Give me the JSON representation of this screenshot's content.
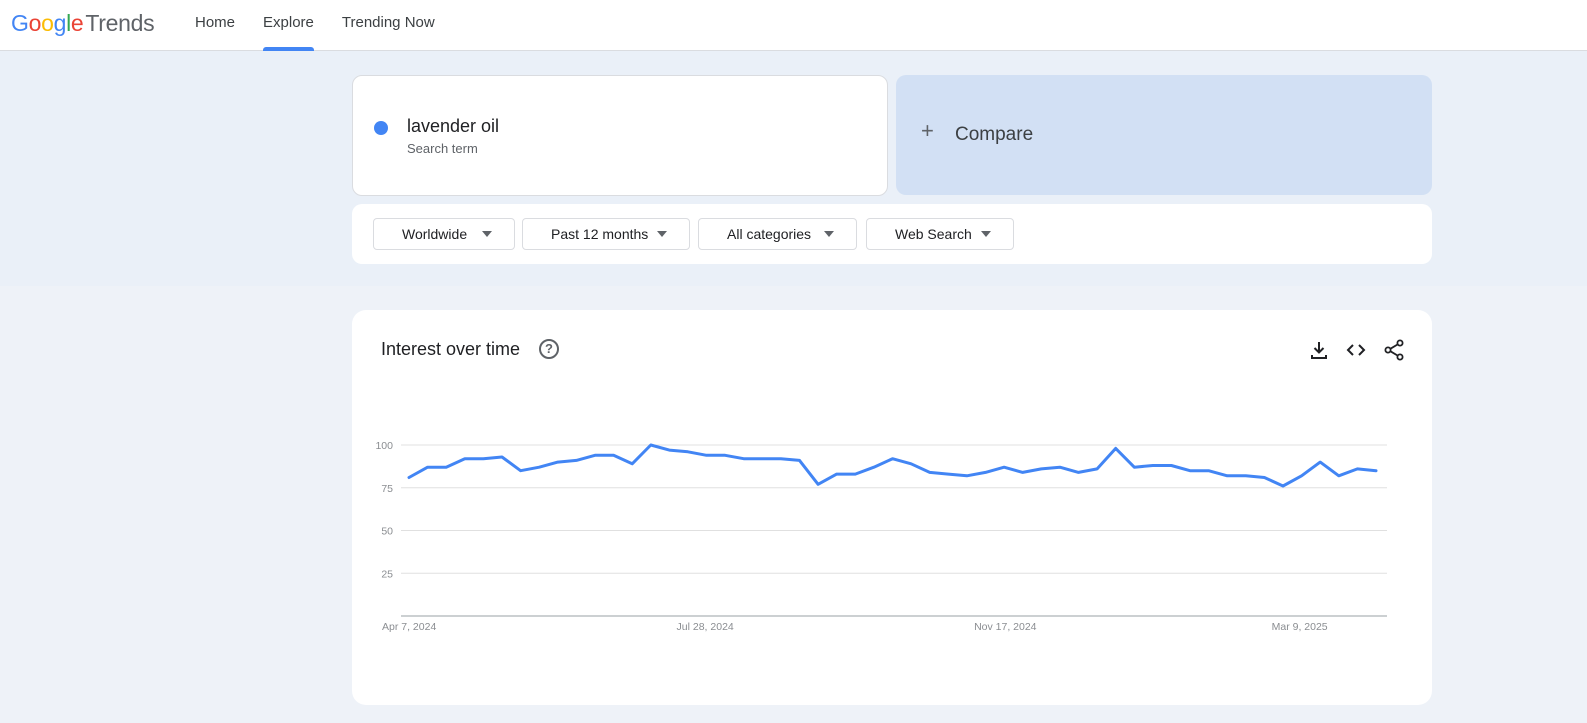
{
  "header": {
    "logo_google": "Google",
    "logo_trends": "Trends",
    "nav": [
      {
        "label": "Home",
        "active": false
      },
      {
        "label": "Explore",
        "active": true
      },
      {
        "label": "Trending Now",
        "active": false
      }
    ]
  },
  "search": {
    "term": "lavender oil",
    "term_type": "Search term",
    "term_color": "#4285f4",
    "compare_label": "Compare"
  },
  "filters": {
    "region": "Worldwide",
    "time_range": "Past 12 months",
    "category": "All categories",
    "search_type": "Web Search"
  },
  "interest_over_time": {
    "title": "Interest over time",
    "tools": [
      "download-icon",
      "embed-code-icon",
      "share-icon"
    ]
  },
  "chart_data": {
    "type": "line",
    "title": "Interest over time",
    "ylim": [
      0,
      100
    ],
    "y_ticks": [
      25,
      50,
      75,
      100
    ],
    "grid": true,
    "x_tick_labels": [
      "Apr 7, 2024",
      "Jul 28, 2024",
      "Nov 17, 2024",
      "Mar 9, 2025"
    ],
    "x_tick_index": [
      0,
      16,
      32,
      48
    ],
    "series": [
      {
        "name": "lavender oil",
        "color": "#4285f4",
        "values": [
          81,
          87,
          87,
          92,
          92,
          93,
          85,
          87,
          90,
          91,
          94,
          94,
          89,
          100,
          97,
          96,
          94,
          94,
          92,
          92,
          92,
          91,
          77,
          83,
          83,
          87,
          92,
          89,
          84,
          83,
          82,
          84,
          87,
          84,
          86,
          87,
          84,
          86,
          98,
          87,
          88,
          88,
          85,
          85,
          82,
          82,
          81,
          76,
          82,
          90,
          82,
          86,
          85
        ]
      }
    ]
  }
}
